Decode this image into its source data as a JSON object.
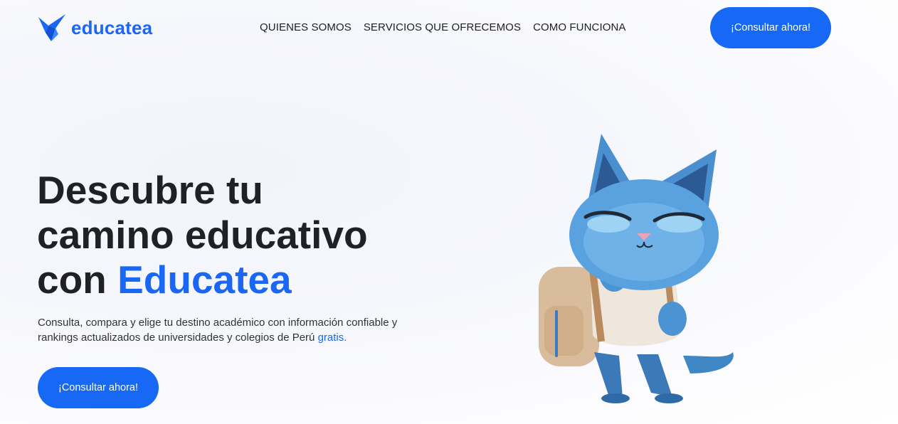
{
  "header": {
    "logo_text": "educatea",
    "logo_icon": "origami-bird-icon",
    "nav": [
      {
        "label": "QUIENES SOMOS"
      },
      {
        "label": "SERVICIOS QUE OFRECEMOS"
      },
      {
        "label": "COMO FUNCIONA"
      }
    ],
    "cta_label": "¡Consultar ahora!"
  },
  "hero": {
    "title_line1": "Descubre tu",
    "title_line2": "camino educativo",
    "title_line3_prefix": "con ",
    "title_line3_accent": "Educatea",
    "description": "Consulta, compara y elige tu destino académico con información confiable y rankings actualizados de universidades y colegios de Perú ",
    "description_link": "gratis.",
    "cta_label": "¡Consultar ahora!",
    "illustration": "cat-student-mascot"
  },
  "colors": {
    "primary": "#1668f5",
    "text": "#202124",
    "background": "#f3f5fb"
  }
}
